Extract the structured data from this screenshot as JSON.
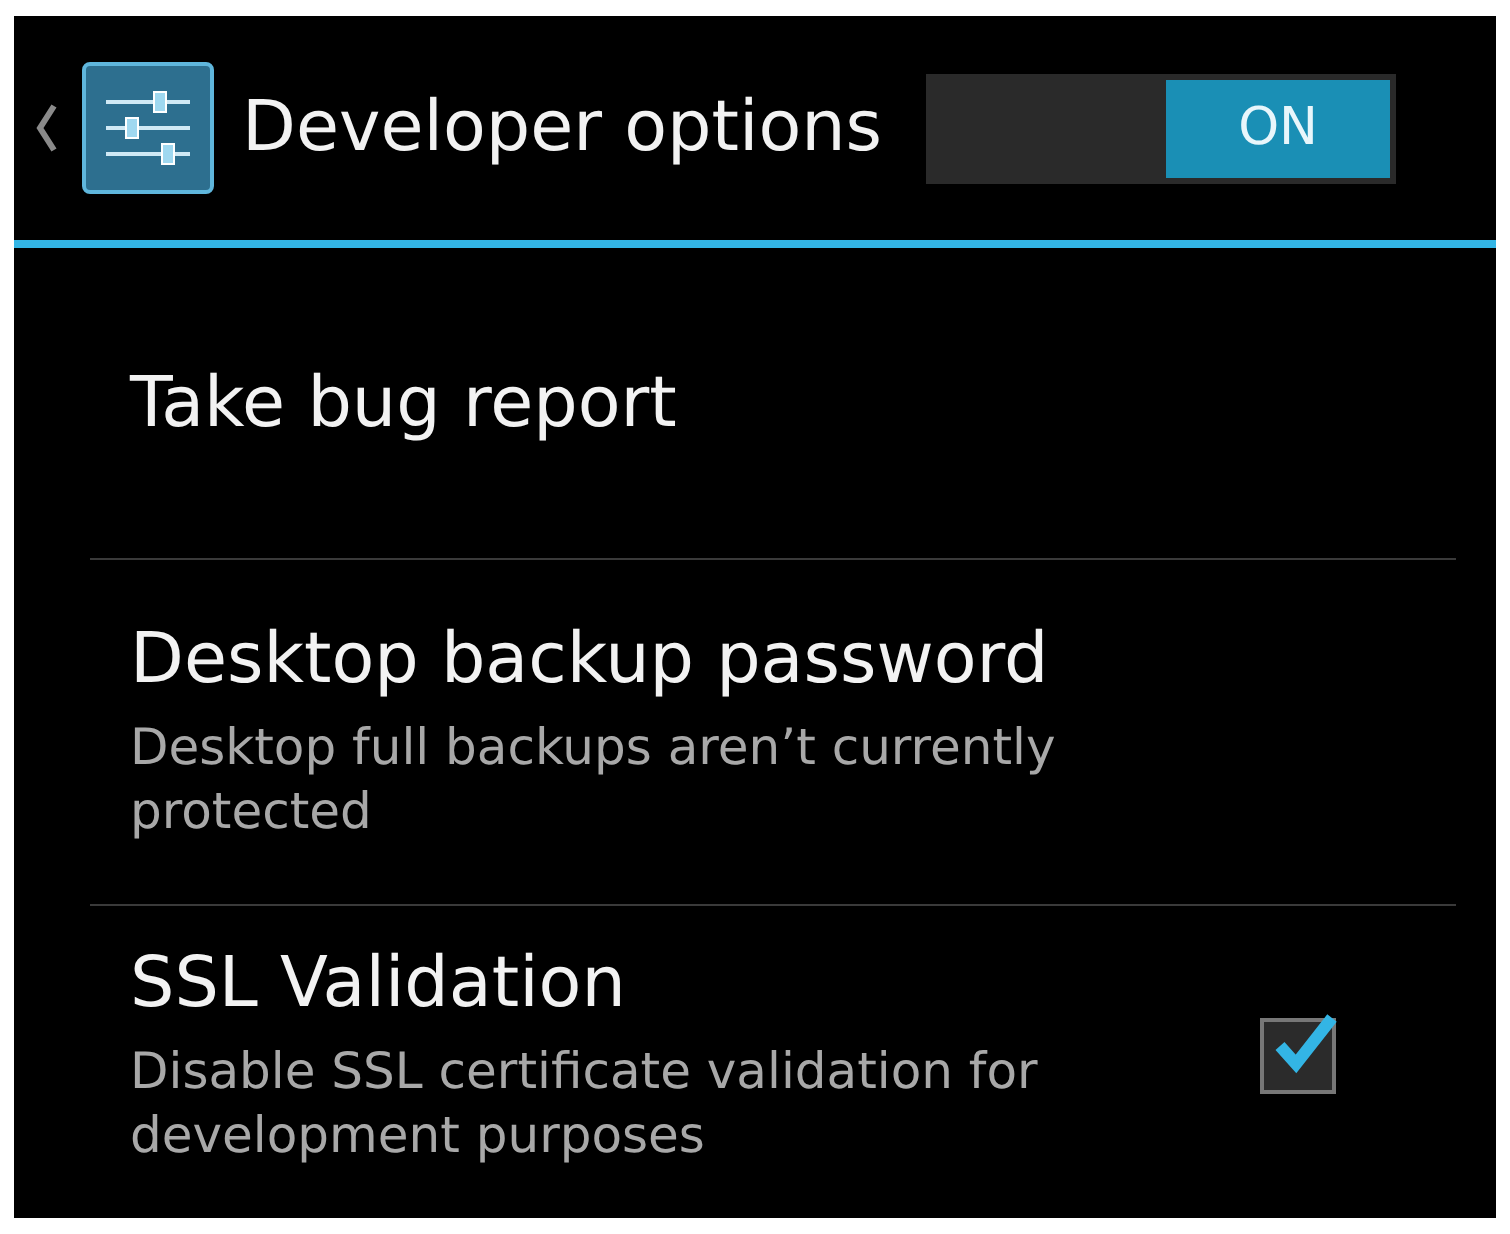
{
  "header": {
    "title": "Developer options",
    "toggle": {
      "label": "ON",
      "on": true
    }
  },
  "items": [
    {
      "kind": "plain",
      "title": "Take bug report"
    },
    {
      "kind": "plain",
      "title": "Desktop backup password",
      "summary": "Desktop full backups aren’t currently protected"
    },
    {
      "kind": "checkbox",
      "title": "SSL Validation",
      "summary": "Disable SSL certificate validation for development purposes",
      "checked": true
    }
  ]
}
